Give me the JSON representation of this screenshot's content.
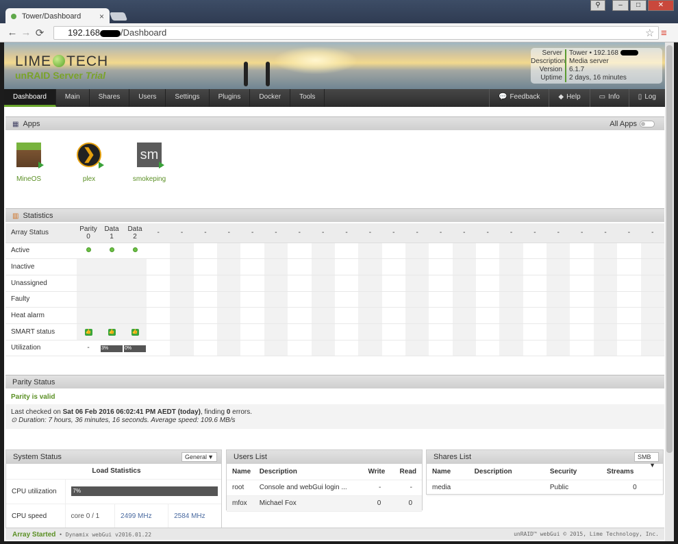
{
  "browser": {
    "tab_title": "Tower/Dashboard",
    "tab_close": "×",
    "url_host": "192.168",
    "url_path": "/Dashboard",
    "back": "←",
    "forward": "→",
    "reload": "⟳",
    "star": "☆",
    "menu": "≡",
    "win_user": "⚲",
    "win_min": "–",
    "win_max": "□",
    "win_close": "✕"
  },
  "brand": {
    "logo_left": "LIME",
    "logo_right": "TECH",
    "product": "unRAID Server",
    "edition": "Trial"
  },
  "server_info": [
    {
      "key": "Server",
      "value": "Tower • 192.168"
    },
    {
      "key": "Description",
      "value": "Media server"
    },
    {
      "key": "Version",
      "value": "6.1.7"
    },
    {
      "key": "Uptime",
      "value": "2 days, 16 minutes"
    }
  ],
  "nav": {
    "items": [
      "Dashboard",
      "Main",
      "Shares",
      "Users",
      "Settings",
      "Plugins",
      "Docker",
      "Tools"
    ],
    "right": [
      {
        "icon": "💬",
        "label": "Feedback"
      },
      {
        "icon": "◆",
        "label": "Help"
      },
      {
        "icon": "▭",
        "label": "Info"
      },
      {
        "icon": "▯",
        "label": "Log"
      }
    ]
  },
  "apps": {
    "title": "Apps",
    "all_apps": "All Apps",
    "items": [
      {
        "name": "MineOS",
        "glyph": ""
      },
      {
        "name": "plex",
        "glyph": "❯"
      },
      {
        "name": "smokeping",
        "glyph": "sm"
      }
    ]
  },
  "statistics": {
    "title": "Statistics",
    "header_label": "Array Status",
    "columns": [
      [
        "Parity",
        "0"
      ],
      [
        "Data",
        "1"
      ],
      [
        "Data",
        "2"
      ]
    ],
    "filler": "-",
    "rows": [
      "Active",
      "Inactive",
      "Unassigned",
      "Faulty",
      "Heat alarm",
      "SMART status",
      "Utilization"
    ],
    "smart_glyph": "👍",
    "utilization": [
      "-",
      "3%",
      "0%"
    ]
  },
  "parity": {
    "title": "Parity Status",
    "valid": "Parity is valid",
    "line1_pre": "Last checked on ",
    "line1_date": "Sat 06 Feb 2016 06:02:41 PM AEDT (today)",
    "line1_mid": ", finding ",
    "line1_errors": "0",
    "line1_post": " errors.",
    "line2_icon": "⊙",
    "line2": "Duration: 7 hours, 36 minutes, 16 seconds. Average speed: 109.6 MB/s"
  },
  "system_status": {
    "title": "System Status",
    "select": "General",
    "caret": "▼",
    "subtitle": "Load Statistics",
    "cpu_label": "CPU utilization",
    "cpu_value": "7%",
    "cpu_speed_label": "CPU speed",
    "cores": "core 0 / 1",
    "speed1": "2499 MHz",
    "speed2": "2584 MHz"
  },
  "users_list": {
    "title": "Users List",
    "headers": [
      "Name",
      "Description",
      "Write",
      "Read"
    ],
    "rows": [
      [
        "root",
        "Console and webGui login ...",
        "-",
        "-"
      ],
      [
        "mfox",
        "Michael Fox",
        "0",
        "0"
      ]
    ]
  },
  "shares_list": {
    "title": "Shares List",
    "select": "SMB",
    "headers": [
      "Name",
      "Description",
      "Security",
      "Streams"
    ],
    "rows": [
      [
        "media",
        "",
        "Public",
        "0"
      ]
    ]
  },
  "footer": {
    "status": "Array Started",
    "version": " • Dynamix webGui v2016.01.22",
    "copyright": "unRAID™ webGui © 2015, Lime Technology, Inc."
  }
}
